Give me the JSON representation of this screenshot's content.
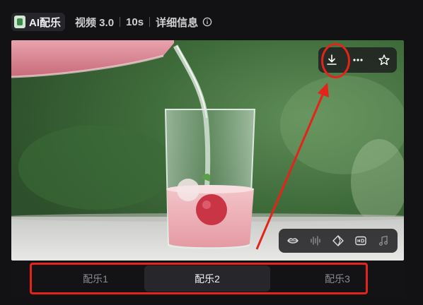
{
  "header": {
    "badge_label": "AI配乐",
    "model": "视频 3.0",
    "duration": "10s",
    "details_label": "详细信息"
  },
  "icons": {
    "badge": "music-thumbnail-icon",
    "info": "info-icon",
    "download": "download-icon",
    "more": "more-dots-icon",
    "favorite": "star-icon",
    "lip_sync": "lips-icon",
    "audio_wave": "waveform-icon",
    "diamond": "diamond-icon",
    "hd": "hd-icon",
    "music": "music-note-icon"
  },
  "tabs": [
    {
      "label": "配乐1",
      "active": false
    },
    {
      "label": "配乐2",
      "active": true
    },
    {
      "label": "配乐3",
      "active": false
    }
  ],
  "colors": {
    "annotation": "#e3241a",
    "background": "#121214"
  }
}
